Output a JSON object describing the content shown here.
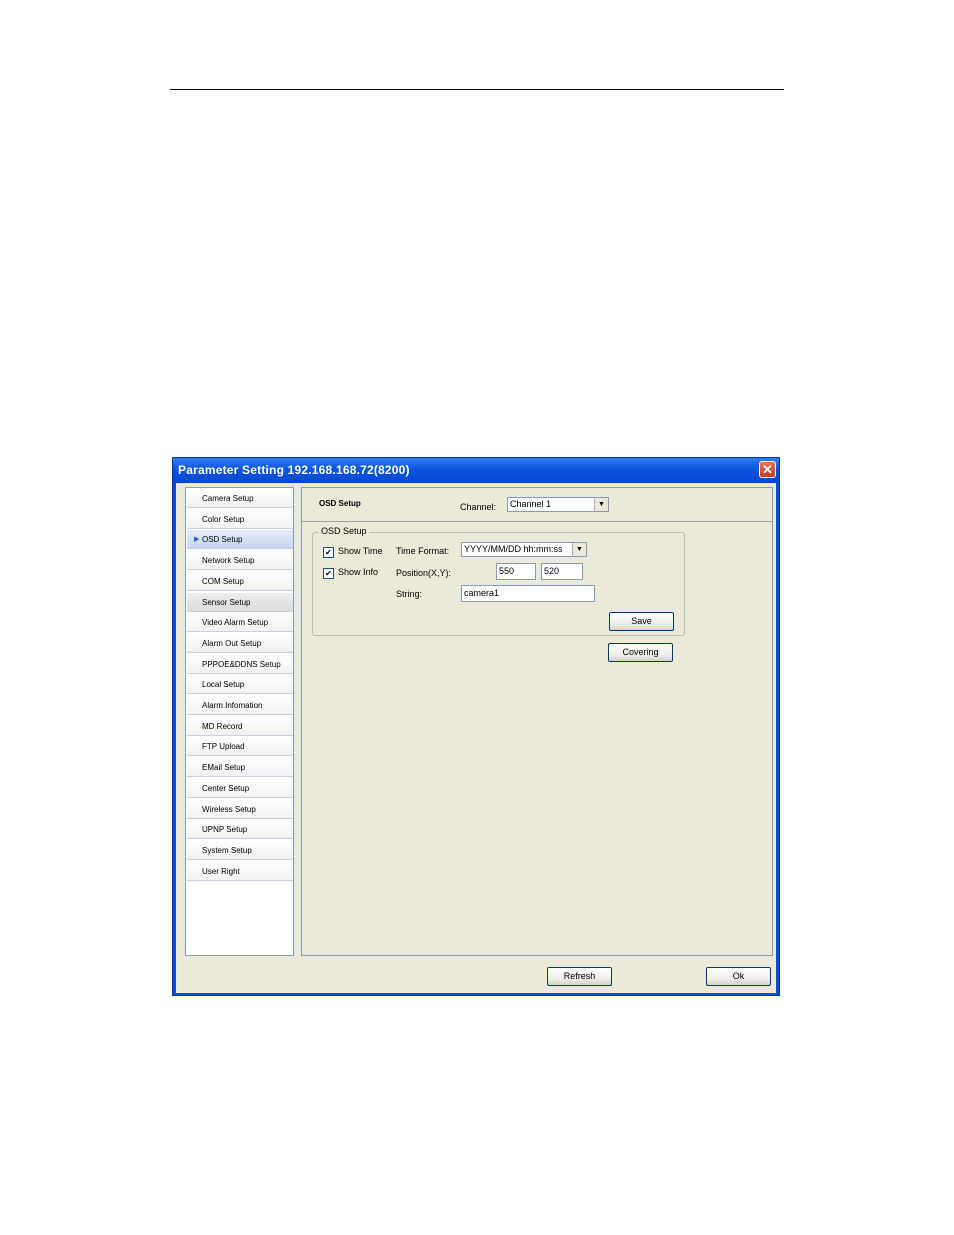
{
  "window": {
    "title": "Parameter Setting 192.168.168.72(8200)",
    "close_glyph": "✕"
  },
  "sidebar": {
    "active_index": 2,
    "items": [
      {
        "label": "Camera Setup"
      },
      {
        "label": "Color Setup"
      },
      {
        "label": "OSD Setup"
      },
      {
        "label": "Network Setup"
      },
      {
        "label": "COM Setup"
      },
      {
        "label": "Sensor Setup"
      },
      {
        "label": "Video Alarm Setup"
      },
      {
        "label": "Alarm Out Setup"
      },
      {
        "label": "PPPOE&DDNS Setup"
      },
      {
        "label": "Local Setup"
      },
      {
        "label": "Alarm Infomation"
      },
      {
        "label": "MD Record"
      },
      {
        "label": "FTP Upload"
      },
      {
        "label": "EMail Setup"
      },
      {
        "label": "Center Setup"
      },
      {
        "label": "Wireless Setup"
      },
      {
        "label": "UPNP Setup"
      },
      {
        "label": "System Setup"
      },
      {
        "label": "User Right"
      }
    ]
  },
  "osd": {
    "header_title": "OSD Setup",
    "channel_label": "Channel:",
    "channel_value": "Channel 1",
    "group_title": "OSD Setup",
    "show_time_label": "Show Time",
    "show_time_checked": true,
    "show_info_label": "Show Info",
    "show_info_checked": true,
    "time_format_label": "Time Format:",
    "time_format_value": "YYYY/MM/DD hh:mm:ss",
    "position_label": "Position(X,Y):",
    "position_x": "550",
    "position_y": "520",
    "string_label": "String:",
    "string_value": "camera1",
    "save_label": "Save",
    "covering_label": "Covering"
  },
  "footer": {
    "refresh_label": "Refresh",
    "ok_label": "Ok"
  }
}
